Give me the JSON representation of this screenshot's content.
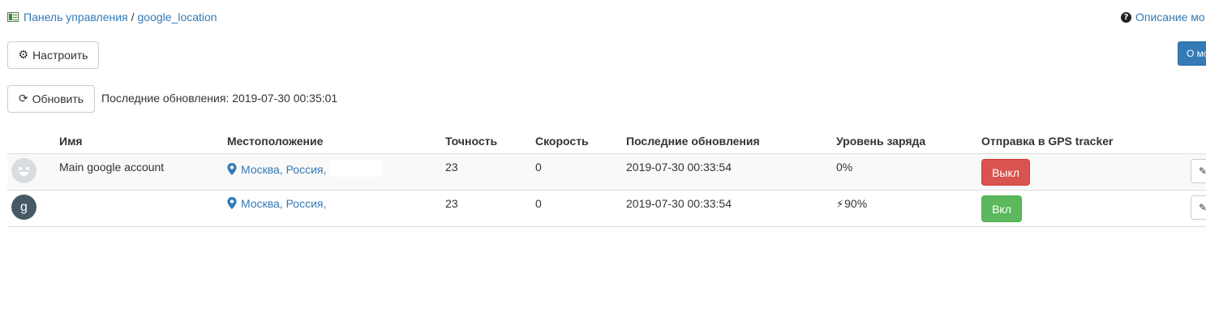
{
  "breadcrumb": {
    "root": "Панель управления",
    "separator": "/",
    "current": "google_location",
    "icon": "module-icon"
  },
  "help": {
    "label": "Описание мо",
    "icon": "question-circle-icon"
  },
  "toolbar": {
    "configure_label": "Настроить",
    "configure_icon": "gear-icon",
    "about_label": "О мо",
    "refresh_label": "Обновить",
    "refresh_icon": "refresh-icon",
    "last_update_text": "Последние обновления: 2019-07-30 00:35:01"
  },
  "table": {
    "headers": {
      "name": "Имя",
      "location": "Местоположение",
      "accuracy": "Точность",
      "speed": "Скорость",
      "last_update": "Последние обновления",
      "battery": "Уровень заряда",
      "gps": "Отправка в GPS tracker"
    },
    "rows": [
      {
        "avatar": "smiley-avatar",
        "name": "Main google account",
        "location": "Москва, Россия,",
        "accuracy": "23",
        "speed": "0",
        "last_update": "2019-07-30 00:33:54",
        "battery": "0%",
        "charging": false,
        "gps_label": "Выкл",
        "gps_state": "off"
      },
      {
        "avatar": "letter-avatar",
        "avatar_letter": "g",
        "name": "",
        "location": "Москва, Россия,",
        "accuracy": "23",
        "speed": "0",
        "last_update": "2019-07-30 00:33:54",
        "battery": "90%",
        "charging": true,
        "gps_label": "Вкл",
        "gps_state": "on"
      }
    ]
  },
  "colors": {
    "link": "#337ab7",
    "danger": "#d9534f",
    "success": "#5cb85c",
    "primary": "#337ab7",
    "avatar_dark": "#455a64"
  }
}
